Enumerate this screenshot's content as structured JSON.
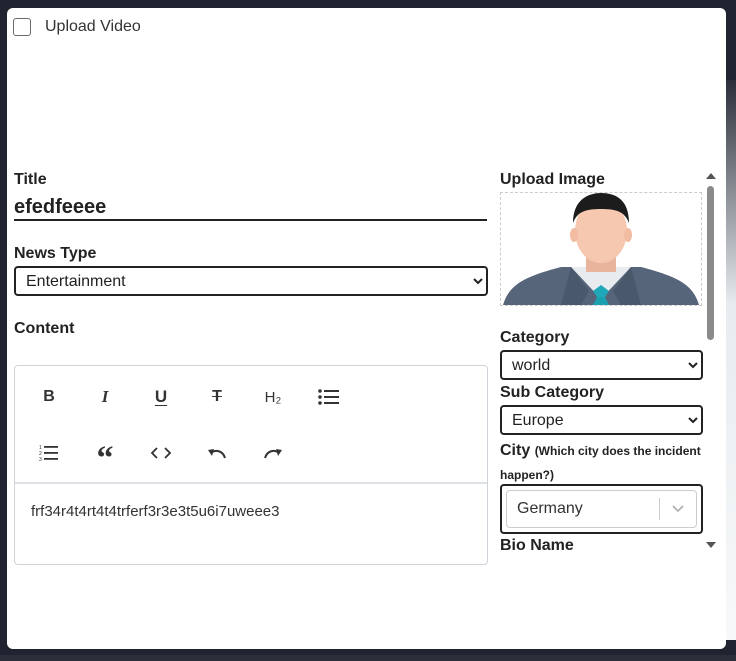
{
  "upload_video": {
    "label": "Upload Video",
    "checked": false
  },
  "title": {
    "label": "Title",
    "value": "efedfeeee"
  },
  "news_type": {
    "label": "News Type",
    "selected": "Entertainment"
  },
  "content": {
    "label": "Content",
    "toolbar": {
      "row1": [
        "bold-icon",
        "italic-icon",
        "underline-icon",
        "strikethrough-icon",
        "heading-icon",
        "bullet-list-icon"
      ],
      "row2": [
        "numbered-list-icon",
        "quote-icon",
        "code-icon",
        "undo-icon",
        "redo-icon"
      ],
      "heading_glyph": "H₂"
    },
    "text": "frf34r4t4rt4t4trferf3r3e3t5u6i7uweee3"
  },
  "upload_image": {
    "label": "Upload Image",
    "image": "male-avatar-placeholder"
  },
  "category": {
    "label": "Category",
    "selected": "world"
  },
  "sub_category": {
    "label": "Sub Category",
    "selected": "Europe"
  },
  "city": {
    "label": "City",
    "hint": "(Which city does the incident happen?)",
    "selected": "Germany"
  },
  "bio_name": {
    "label": "Bio Name"
  },
  "colors": {
    "text": "#222222",
    "tie": "#1fa9b8",
    "suit": "#56657a",
    "skin": "#f7c8b0",
    "hair": "#1c1c1c"
  }
}
